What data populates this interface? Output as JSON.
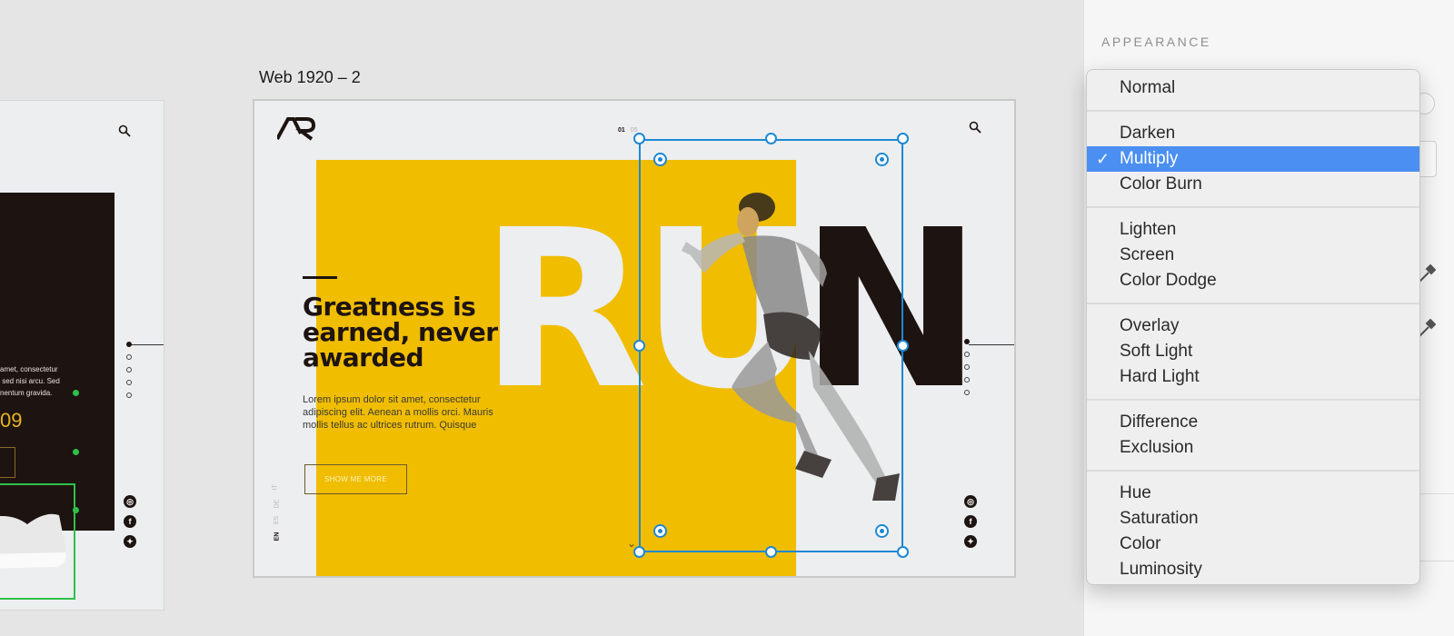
{
  "artboard_left": {
    "body_text": "amet, consectetur\n sed nisi arcu. Sed\nnentum gravida.",
    "price": "09",
    "nav_dots": 5,
    "social": [
      "instagram-icon",
      "facebook-icon",
      "twitter-icon"
    ]
  },
  "artboard_main": {
    "title": "Web 1920 – 2",
    "logo": "AR",
    "counter_current": "01",
    "counter_total": "05",
    "hero_word_light": "RU",
    "hero_word_dark": "N",
    "headline": "Greatness is earned, never awarded",
    "body": "Lorem ipsum dolor sit amet, consectetur adipiscing elit. Aenean a mollis orci. Mauris mollis tellus ac ultrices rutrum. Quisque",
    "cta": "SHOW ME MORE",
    "languages": [
      "EN",
      "ES",
      "DE",
      "IT"
    ],
    "active_language": "EN",
    "nav_dots": 5,
    "social": [
      "instagram-icon",
      "facebook-icon",
      "twitter-icon"
    ],
    "colors": {
      "yellow": "#f0bd00",
      "dark": "#1d1310",
      "bg": "#eceef0"
    }
  },
  "selection": {
    "color": "#1e88d2",
    "secondary_color": "#2ec04a"
  },
  "panel": {
    "section_title": "APPEARANCE"
  },
  "blend_menu": {
    "selected": "Multiply",
    "highlight_color": "#4a8ff1",
    "groups": [
      [
        "Normal"
      ],
      [
        "Darken",
        "Multiply",
        "Color Burn"
      ],
      [
        "Lighten",
        "Screen",
        "Color Dodge"
      ],
      [
        "Overlay",
        "Soft Light",
        "Hard Light"
      ],
      [
        "Difference",
        "Exclusion"
      ],
      [
        "Hue",
        "Saturation",
        "Color",
        "Luminosity"
      ]
    ]
  }
}
